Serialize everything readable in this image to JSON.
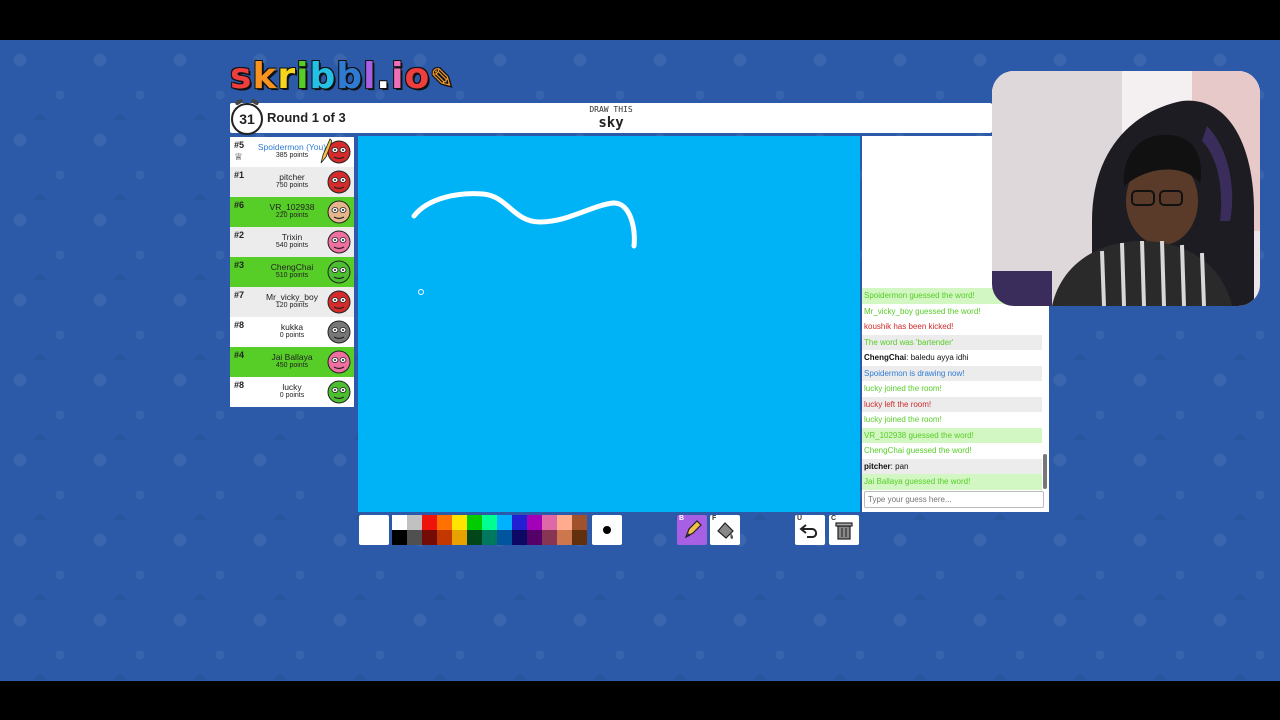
{
  "logo": {
    "text": "skribbl.io",
    "letters": [
      "s",
      "k",
      "r",
      "i",
      "b",
      "b",
      "l",
      ".",
      "i",
      "o"
    ],
    "colors": [
      "#ef3e3e",
      "#f7931e",
      "#f7d51d",
      "#56ce27",
      "#24c0e5",
      "#2f7bd4",
      "#a75fe3",
      "#ffffff",
      "#ef6fb6",
      "#ef3e3e"
    ]
  },
  "header": {
    "timer": "31",
    "round": "Round 1 of 3",
    "draw_label": "DRAW THIS",
    "word": "sky"
  },
  "players": [
    {
      "rank": "#5",
      "name": "Spoidermon (You)",
      "points": "385 points",
      "row": "white",
      "self": true,
      "drawing": true,
      "owner": true,
      "avatar_color": "#d62b2b"
    },
    {
      "rank": "#1",
      "name": "pitcher",
      "points": "750 points",
      "row": "alt",
      "avatar_color": "#d62b2b"
    },
    {
      "rank": "#6",
      "name": "VR_102938",
      "points": "220 points",
      "row": "green",
      "avatar_color": "#e5b58c"
    },
    {
      "rank": "#2",
      "name": "Trixin",
      "points": "540 points",
      "row": "alt",
      "avatar_color": "#ef6fa0"
    },
    {
      "rank": "#3",
      "name": "ChengChai",
      "points": "510 points",
      "row": "green",
      "avatar_color": "#4cbf30"
    },
    {
      "rank": "#7",
      "name": "Mr_vicky_boy",
      "points": "120 points",
      "row": "alt",
      "avatar_color": "#d62b2b"
    },
    {
      "rank": "#8",
      "name": "kukka",
      "points": "0 points",
      "row": "white",
      "avatar_color": "#777777"
    },
    {
      "rank": "#4",
      "name": "Jai Ballaya",
      "points": "450 points",
      "row": "green",
      "avatar_color": "#ef6fa0"
    },
    {
      "rank": "#8",
      "name": "lucky",
      "points": "0 points",
      "row": "white",
      "avatar_color": "#4cbf30"
    }
  ],
  "chat": {
    "messages": [
      {
        "text": "Spoidermon guessed the word!",
        "style": "gs"
      },
      {
        "text": "Mr_vicky_boy guessed the word!",
        "style": "g"
      },
      {
        "text": "koushik has been kicked!",
        "style": "r"
      },
      {
        "text": "The word was 'bartender'",
        "style": "g shade"
      },
      {
        "author": "ChengChai",
        "text": "baledu ayya idhi",
        "style": "k"
      },
      {
        "text": "Spoidermon is drawing now!",
        "style": "b shade"
      },
      {
        "text": "lucky joined the room!",
        "style": "g"
      },
      {
        "text": "lucky left the room!",
        "style": "r shade"
      },
      {
        "text": "lucky joined the room!",
        "style": "g"
      },
      {
        "text": "VR_102938 guessed the word!",
        "style": "gs"
      },
      {
        "text": "ChengChai guessed the word!",
        "style": "g"
      },
      {
        "author": "pitcher",
        "text": "pan",
        "style": "k shade"
      },
      {
        "text": "Jai Ballaya guessed the word!",
        "style": "gs"
      }
    ],
    "guess_placeholder": "Type your guess here..."
  },
  "canvas": {
    "background": "#00b3f7",
    "stroke_color": "#ffffff"
  },
  "palette": {
    "current_color": "#ffffff",
    "top": [
      "#ffffff",
      "#c1c1c1",
      "#ef130b",
      "#ff7100",
      "#ffe400",
      "#00cc00",
      "#00ff91",
      "#00b2ff",
      "#231fd3",
      "#a300ba",
      "#df69a7",
      "#ffac8e",
      "#a0522d"
    ],
    "bottom": [
      "#000000",
      "#505050",
      "#740b07",
      "#c23800",
      "#e8a200",
      "#004619",
      "#00785d",
      "#00569e",
      "#0e0865",
      "#550069",
      "#873554",
      "#cc774d",
      "#63300d"
    ]
  },
  "tools": [
    {
      "key": "B",
      "name": "brush",
      "active": true
    },
    {
      "key": "F",
      "name": "fill",
      "active": false
    },
    {
      "key": "U",
      "name": "undo",
      "active": false
    },
    {
      "key": "C",
      "name": "clear",
      "active": false
    }
  ]
}
